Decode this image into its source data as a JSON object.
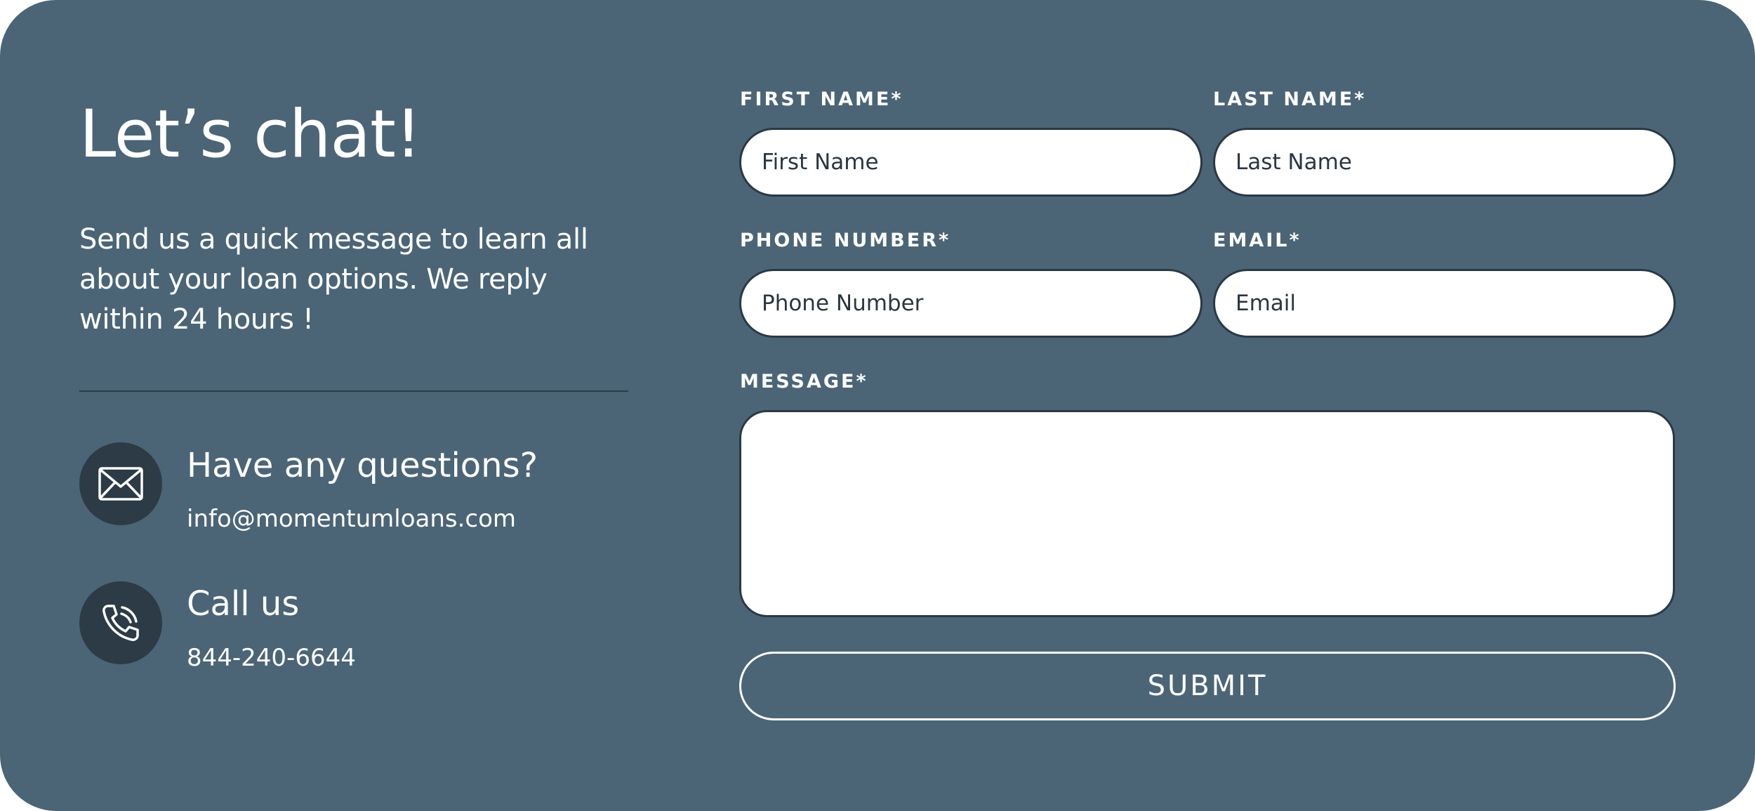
{
  "intro": {
    "heading": "Let’s chat!",
    "text": "Send us a quick message to learn all about your loan options. We reply within 24 hours !"
  },
  "contacts": [
    {
      "icon": "envelope-icon",
      "title": "Have any questions?",
      "detail": "info@momentumloans.com"
    },
    {
      "icon": "phone-icon",
      "title": "Call us",
      "detail": "844-240-6644"
    }
  ],
  "form": {
    "first_name": {
      "label": "FIRST NAME*",
      "placeholder": "First Name",
      "value": ""
    },
    "last_name": {
      "label": "LAST NAME*",
      "placeholder": "Last Name",
      "value": ""
    },
    "phone": {
      "label": "PHONE NUMBER*",
      "placeholder": "Phone Number",
      "value": ""
    },
    "email": {
      "label": "EMAIL*",
      "placeholder": "Email",
      "value": ""
    },
    "message": {
      "label": "MESSAGE*",
      "value": ""
    },
    "submit_label": "SUBMIT"
  },
  "colors": {
    "panel_background": "#4b6577",
    "icon_circle": "#2c3b46",
    "field_border": "#2a3945",
    "text_light": "#ffffff"
  }
}
